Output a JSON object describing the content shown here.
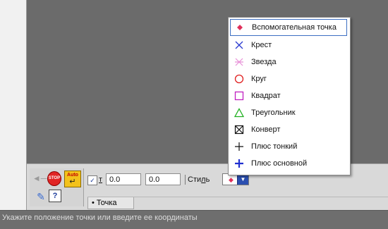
{
  "toolbar": {
    "t_label": "т",
    "x_value": "0.0",
    "y_value": "0.0",
    "style_label_prefix": "Сти",
    "style_label_ul": "л",
    "style_label_suffix": "ь"
  },
  "icons": {
    "stop_text": "STOP",
    "auto_text": "Auto",
    "help_text": "?"
  },
  "tab": {
    "label": "• Точка"
  },
  "status": {
    "text": "Укажите положение точки или введите ее координаты"
  },
  "menu": {
    "items": [
      {
        "label": "Вспомогательная точка",
        "icon": "aux-point-icon",
        "color": "#e0305a",
        "selected": true
      },
      {
        "label": "Крест",
        "icon": "cross-icon",
        "color": "#2a3ad0"
      },
      {
        "label": "Звезда",
        "icon": "star-icon",
        "color": "#e890d8"
      },
      {
        "label": "Круг",
        "icon": "circle-icon",
        "color": "#e02020"
      },
      {
        "label": "Квадрат",
        "icon": "square-icon",
        "color": "#c020c0"
      },
      {
        "label": "Треугольник",
        "icon": "triangle-icon",
        "color": "#20b020"
      },
      {
        "label": "Конверт",
        "icon": "envelope-icon",
        "color": "#111111"
      },
      {
        "label": "Плюс тонкий",
        "icon": "thin-plus-icon",
        "color": "#111111"
      },
      {
        "label": "Плюс основной",
        "icon": "main-plus-icon",
        "color": "#2030d0"
      }
    ]
  }
}
